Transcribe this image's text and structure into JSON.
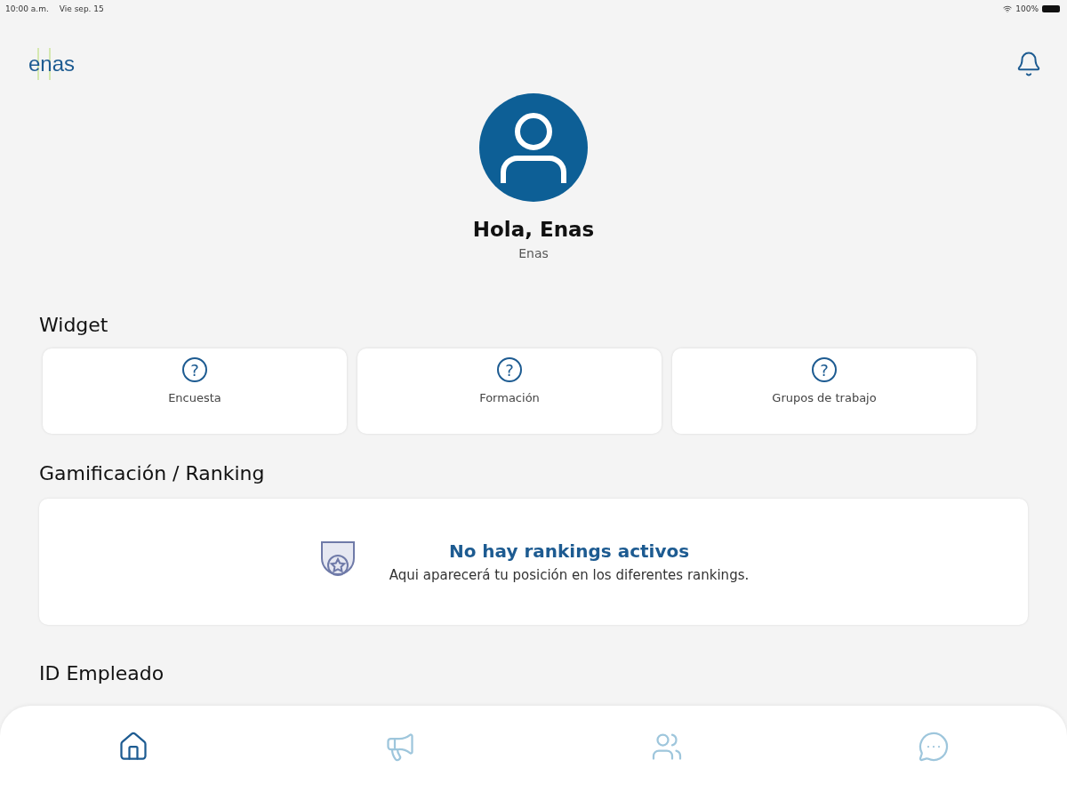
{
  "status_bar": {
    "time": "10:00 a.m.",
    "date": "Vie sep. 15",
    "battery": "100%"
  },
  "header": {
    "logo": "enas"
  },
  "profile": {
    "greeting": "Hola, Enas",
    "name": "Enas"
  },
  "widget_section": {
    "title": "Widget",
    "cards": [
      {
        "label": "Encuesta",
        "icon": "?"
      },
      {
        "label": "Formación",
        "icon": "?"
      },
      {
        "label": "Grupos de trabajo",
        "icon": "?"
      }
    ]
  },
  "ranking_section": {
    "title": "Gamificación / Ranking",
    "empty_title": "No hay rankings activos",
    "empty_text": "Aqui aparecerá tu posición en los diferentes rankings."
  },
  "employee_section": {
    "title": "ID Empleado"
  },
  "bottom_nav": [
    {
      "kind": "home",
      "selected": true
    },
    {
      "kind": "megaphone",
      "selected": false
    },
    {
      "kind": "people",
      "selected": false
    },
    {
      "kind": "chat",
      "selected": false
    }
  ]
}
